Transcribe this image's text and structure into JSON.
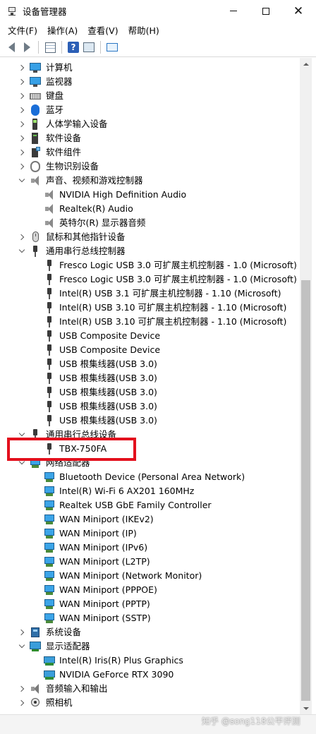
{
  "window": {
    "title": "设备管理器",
    "minimize_icon": "minimize-icon",
    "maximize_icon": "maximize-icon",
    "close_symbol": "✕"
  },
  "menu": [
    "文件(F)",
    "操作(A)",
    "查看(V)",
    "帮助(H)"
  ],
  "toolbar": {
    "icons": [
      "back-arrow-icon",
      "forward-arrow-icon",
      "properties-icon",
      "help-icon",
      "scan-hardware-icon",
      "monitor-icon"
    ],
    "help_glyph": "?"
  },
  "tree": [
    {
      "label": "计算机",
      "icon": "computer-icon",
      "level": 1,
      "state": "collapsed"
    },
    {
      "label": "监视器",
      "icon": "monitor-icon",
      "level": 1,
      "state": "collapsed"
    },
    {
      "label": "键盘",
      "icon": "keyboard-icon",
      "level": 1,
      "state": "collapsed"
    },
    {
      "label": "蓝牙",
      "icon": "bluetooth-icon",
      "level": 1,
      "state": "collapsed"
    },
    {
      "label": "人体学输入设备",
      "icon": "hid-icon",
      "level": 1,
      "state": "collapsed"
    },
    {
      "label": "软件设备",
      "icon": "software-device-icon",
      "level": 1,
      "state": "collapsed"
    },
    {
      "label": "软件组件",
      "icon": "software-component-icon",
      "level": 1,
      "state": "collapsed"
    },
    {
      "label": "生物识别设备",
      "icon": "fingerprint-icon",
      "level": 1,
      "state": "collapsed"
    },
    {
      "label": "声音、视频和游戏控制器",
      "icon": "speaker-icon",
      "level": 1,
      "state": "expanded"
    },
    {
      "label": "NVIDIA High Definition Audio",
      "icon": "speaker-icon",
      "level": 2
    },
    {
      "label": "Realtek(R) Audio",
      "icon": "speaker-icon",
      "level": 2
    },
    {
      "label": "英特尔(R) 显示器音频",
      "icon": "speaker-icon",
      "level": 2
    },
    {
      "label": "鼠标和其他指针设备",
      "icon": "mouse-icon",
      "level": 1,
      "state": "collapsed"
    },
    {
      "label": "通用串行总线控制器",
      "icon": "usb-icon",
      "level": 1,
      "state": "expanded"
    },
    {
      "label": "Fresco Logic USB 3.0 可扩展主机控制器 - 1.0 (Microsoft)",
      "icon": "usb-icon",
      "level": 2
    },
    {
      "label": "Fresco Logic USB 3.0 可扩展主机控制器 - 1.0 (Microsoft)",
      "icon": "usb-icon",
      "level": 2
    },
    {
      "label": "Intel(R) USB 3.1 可扩展主机控制器 - 1.10 (Microsoft)",
      "icon": "usb-icon",
      "level": 2
    },
    {
      "label": "Intel(R) USB 3.10 可扩展主机控制器 - 1.10 (Microsoft)",
      "icon": "usb-icon",
      "level": 2
    },
    {
      "label": "Intel(R) USB 3.10 可扩展主机控制器 - 1.10 (Microsoft)",
      "icon": "usb-icon",
      "level": 2
    },
    {
      "label": "USB Composite Device",
      "icon": "usb-icon",
      "level": 2
    },
    {
      "label": "USB Composite Device",
      "icon": "usb-icon",
      "level": 2
    },
    {
      "label": "USB 根集线器(USB 3.0)",
      "icon": "usb-icon",
      "level": 2
    },
    {
      "label": "USB 根集线器(USB 3.0)",
      "icon": "usb-icon",
      "level": 2
    },
    {
      "label": "USB 根集线器(USB 3.0)",
      "icon": "usb-icon",
      "level": 2
    },
    {
      "label": "USB 根集线器(USB 3.0)",
      "icon": "usb-icon",
      "level": 2
    },
    {
      "label": "USB 根集线器(USB 3.0)",
      "icon": "usb-icon",
      "level": 2
    },
    {
      "label": "通用串行总线设备",
      "icon": "usb-icon",
      "level": 1,
      "state": "expanded"
    },
    {
      "label": "TBX-750FA",
      "icon": "usb-icon",
      "level": 2,
      "highlighted": true
    },
    {
      "label": "网络适配器",
      "icon": "network-icon",
      "level": 1,
      "state": "expanded"
    },
    {
      "label": "Bluetooth Device (Personal Area Network)",
      "icon": "network-icon",
      "level": 2
    },
    {
      "label": "Intel(R) Wi-Fi 6 AX201 160MHz",
      "icon": "network-icon",
      "level": 2
    },
    {
      "label": "Realtek USB GbE Family Controller",
      "icon": "network-icon",
      "level": 2
    },
    {
      "label": "WAN Miniport (IKEv2)",
      "icon": "network-icon",
      "level": 2
    },
    {
      "label": "WAN Miniport (IP)",
      "icon": "network-icon",
      "level": 2
    },
    {
      "label": "WAN Miniport (IPv6)",
      "icon": "network-icon",
      "level": 2
    },
    {
      "label": "WAN Miniport (L2TP)",
      "icon": "network-icon",
      "level": 2
    },
    {
      "label": "WAN Miniport (Network Monitor)",
      "icon": "network-icon",
      "level": 2
    },
    {
      "label": "WAN Miniport (PPPOE)",
      "icon": "network-icon",
      "level": 2
    },
    {
      "label": "WAN Miniport (PPTP)",
      "icon": "network-icon",
      "level": 2
    },
    {
      "label": "WAN Miniport (SSTP)",
      "icon": "network-icon",
      "level": 2
    },
    {
      "label": "系统设备",
      "icon": "system-device-icon",
      "level": 1,
      "state": "collapsed"
    },
    {
      "label": "显示适配器",
      "icon": "display-adapter-icon",
      "level": 1,
      "state": "expanded"
    },
    {
      "label": "Intel(R) Iris(R) Plus Graphics",
      "icon": "gpu-icon",
      "level": 2
    },
    {
      "label": "NVIDIA GeForce RTX 3090",
      "icon": "gpu-icon",
      "level": 2
    },
    {
      "label": "音频输入和输出",
      "icon": "audio-io-icon",
      "level": 1,
      "state": "collapsed"
    },
    {
      "label": "照相机",
      "icon": "camera-icon",
      "level": 1,
      "state": "collapsed"
    }
  ],
  "highlight_color": "#e3101d",
  "watermark": "知乎 @song118公平评测"
}
